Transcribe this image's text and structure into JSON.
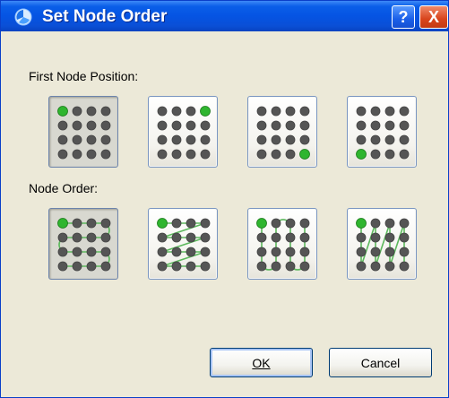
{
  "window": {
    "title": "Set Node Order",
    "help_label": "?",
    "close_label": "X"
  },
  "sections": {
    "first_node_position": "First Node Position:",
    "node_order": "Node Order:"
  },
  "colors": {
    "accent_node": "#2fb52f",
    "node": "#555555",
    "path": "#5cb85c"
  },
  "first_node_options": [
    {
      "name": "top-left",
      "selected": true
    },
    {
      "name": "top-right",
      "selected": false
    },
    {
      "name": "bottom-right",
      "selected": false
    },
    {
      "name": "bottom-left",
      "selected": false
    }
  ],
  "node_order_options": [
    {
      "name": "row-snake",
      "selected": true
    },
    {
      "name": "row-zigzag",
      "selected": false
    },
    {
      "name": "column-snake",
      "selected": false
    },
    {
      "name": "column-zigzag",
      "selected": false
    }
  ],
  "buttons": {
    "ok": "OK",
    "cancel": "Cancel"
  }
}
